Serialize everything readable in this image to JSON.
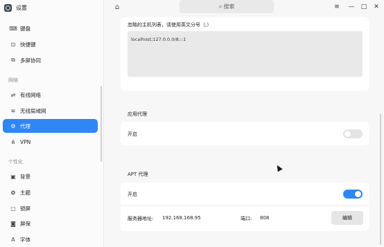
{
  "app": {
    "title": "设置",
    "icon": "settings-app-icon"
  },
  "sidebar": {
    "items_top": [
      {
        "label": "键盘",
        "icon": "keyboard-icon"
      },
      {
        "label": "快捷键",
        "icon": "shortcut-icon"
      },
      {
        "label": "多屏协同",
        "icon": "multiscreen-icon"
      }
    ],
    "section_network": "网络",
    "items_network": [
      {
        "label": "有线网络",
        "icon": "wired-network-icon"
      },
      {
        "label": "无线局域网",
        "icon": "wifi-icon"
      },
      {
        "label": "代理",
        "icon": "proxy-icon",
        "active": true
      },
      {
        "label": "VPN",
        "icon": "vpn-icon"
      }
    ],
    "section_personal": "个性化",
    "items_personal": [
      {
        "label": "背景",
        "icon": "wallpaper-icon"
      },
      {
        "label": "主题",
        "icon": "theme-icon"
      },
      {
        "label": "锁屏",
        "icon": "lock-screen-icon"
      },
      {
        "label": "屏保",
        "icon": "screensaver-icon"
      },
      {
        "label": "字体",
        "icon": "font-icon"
      }
    ]
  },
  "topbar": {
    "search_placeholder": "搜索"
  },
  "ignore_hosts": {
    "label": "忽略的主机列表，请使用英文分号（;）",
    "value": "localhost;127.0.0.0/8;::1"
  },
  "app_proxy": {
    "heading": "应用代理",
    "enable_label": "开启",
    "enabled": false
  },
  "apt_proxy": {
    "heading": "APT 代理",
    "enable_label": "开启",
    "enabled": true,
    "server_label": "服务器地址:",
    "server_value": "192.168.168.95",
    "port_label": "端口:",
    "port_value": "808",
    "edit_label": "编辑"
  },
  "colors": {
    "accent": "#2f86f5",
    "card": "#ffffff",
    "field": "#e9e9e9"
  }
}
